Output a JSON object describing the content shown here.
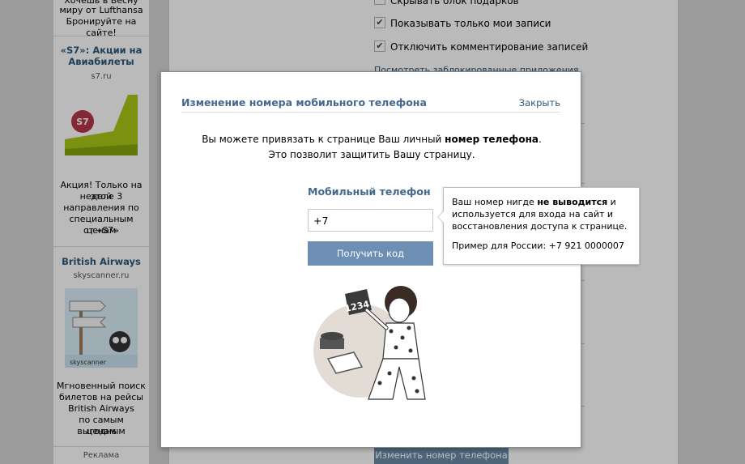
{
  "sidebar_ads": {
    "lufthansa_text_1": "Хочешь в Весну",
    "lufthansa_text_2": "миру от Lufthansa",
    "lufthansa_text_3": "Бронируйте на сайте!",
    "s7": {
      "title_1": "«S7»: Акции на",
      "title_2": "Авиабилеты",
      "domain": "s7.ru",
      "logo_text": "S7",
      "text_lines": [
        "Акция! Только на этой",
        "неделе 3",
        "направления по",
        "специальным ценам",
        "от «S7»"
      ]
    },
    "british_airways": {
      "title": "British Airways",
      "domain": "skyscanner.ru",
      "brand": "skyscanner",
      "text_lines": [
        "Мгновенный поиск",
        "билетов на рейсы",
        "British Airways",
        "по самым выгодным",
        "ценам"
      ]
    },
    "ads_label": "Реклама"
  },
  "settings": {
    "hide_gifts": "Скрывать блок подарков",
    "show_only_my_posts": "Показывать только мои записи",
    "disable_comments": "Отключить комментирование записей",
    "blocked_apps_link": "Посмотреть заблокированные приложения",
    "change_phone_button": "Изменить номер телефона"
  },
  "modal": {
    "title": "Изменение номера мобильного телефона",
    "close": "Закрыть",
    "intro_part1": "Вы можете привязать к странице Ваш личный ",
    "intro_bold": "номер телефона",
    "intro_part2": ".",
    "intro_line2": "Это позволит защитить Вашу страницу.",
    "field_label": "Мобильный телефон",
    "phone_value": "+7",
    "get_code_button": "Получить код",
    "illustration_number": "1234"
  },
  "tooltip": {
    "line1_part1": "Ваш номер нигде ",
    "line1_bold": "не выводится",
    "line1_part2": " и",
    "line2": "используется для входа на сайт и",
    "line3": "восстановления доступа к странице.",
    "example": "Пример для России: +7 921 0000007"
  },
  "colors": {
    "link": "#2b587a",
    "title": "#45688e",
    "button": "#6d8fb3",
    "s7_green": "#a8c614"
  }
}
